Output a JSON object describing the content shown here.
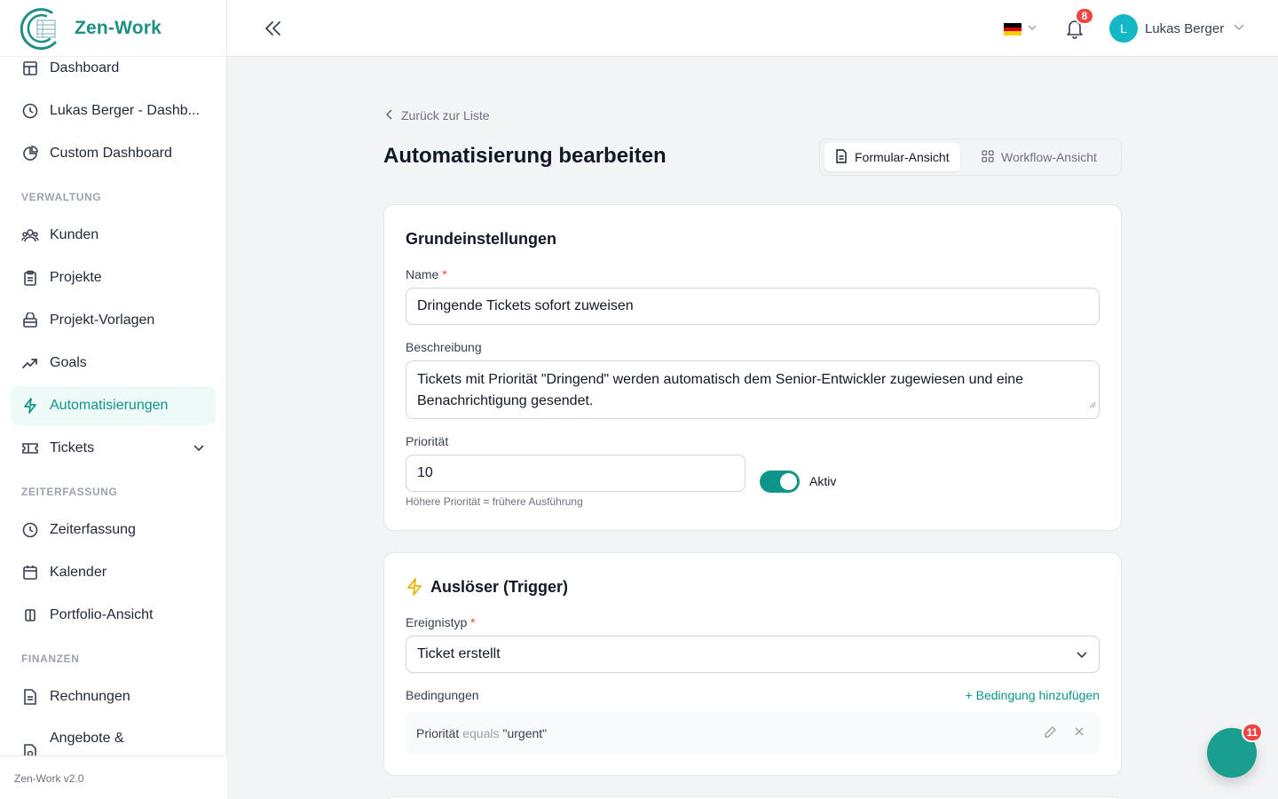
{
  "brand": {
    "name": "Zen-Work",
    "version": "Zen-Work v2.0"
  },
  "sidebar": {
    "items": [
      {
        "label": "Dashboard",
        "icon": "dashboard-icon"
      },
      {
        "label": "Lukas Berger - Dashb...",
        "icon": "clock-icon"
      },
      {
        "label": "Custom Dashboard",
        "icon": "pie-chart-icon"
      },
      {
        "label": "Kunden",
        "icon": "users-icon"
      },
      {
        "label": "Projekte",
        "icon": "clipboard-icon"
      },
      {
        "label": "Projekt-Vorlagen",
        "icon": "template-icon"
      },
      {
        "label": "Goals",
        "icon": "trending-up-icon"
      },
      {
        "label": "Automatisierungen",
        "icon": "lightning-icon",
        "active": true
      },
      {
        "label": "Tickets",
        "icon": "ticket-icon",
        "expandable": true
      },
      {
        "label": "Zeiterfassung",
        "icon": "clock-icon"
      },
      {
        "label": "Kalender",
        "icon": "calendar-icon"
      },
      {
        "label": "Portfolio-Ansicht",
        "icon": "columns-icon"
      },
      {
        "label": "Rechnungen",
        "icon": "invoice-icon"
      },
      {
        "label": "Angebote &",
        "icon": "offer-icon"
      }
    ],
    "sections": [
      "VERWALTUNG",
      "ZEITERFASSUNG",
      "FINANZEN"
    ]
  },
  "topbar": {
    "notification_count": "8",
    "user_initial": "L",
    "user_name": "Lukas Berger",
    "language": "de"
  },
  "page": {
    "back_label": "Zurück zur Liste",
    "title": "Automatisierung bearbeiten",
    "view_form": "Formular-Ansicht",
    "view_workflow": "Workflow-Ansicht"
  },
  "basic": {
    "title": "Grundeinstellungen",
    "name_label": "Name",
    "name_value": "Dringende Tickets sofort zuweisen",
    "desc_label": "Beschreibung",
    "desc_value": "Tickets mit Priorität \"Dringend\" werden automatisch dem Senior-Entwickler zugewiesen und eine Benachrichtigung gesendet.",
    "priority_label": "Priorität",
    "priority_value": "10",
    "priority_hint": "Höhere Priorität = frühere Ausführung",
    "active_label": "Aktiv",
    "active": true
  },
  "trigger": {
    "title": "Auslöser (Trigger)",
    "event_label": "Ereignistyp",
    "event_value": "Ticket erstellt",
    "conditions_label": "Bedingungen",
    "add_condition": "+ Bedingung hinzufügen",
    "condition": {
      "field": "Priorität",
      "operator": "equals",
      "value": "\"urgent\""
    }
  },
  "chat": {
    "badge": "11"
  },
  "colors": {
    "accent": "#0e9488",
    "brand": "#1f8f86",
    "danger": "#ef4444",
    "active_bg": "#eefaf8"
  }
}
